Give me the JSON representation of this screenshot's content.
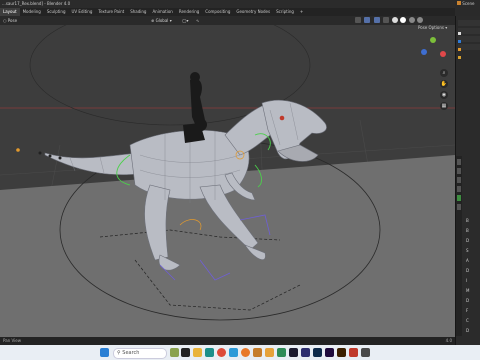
{
  "window": {
    "title": "...saur17_Rex.blend] - Blender 4.0"
  },
  "menubar": {
    "tabs": [
      "Layout",
      "Modeling",
      "Sculpting",
      "UV Editing",
      "Texture Paint",
      "Shading",
      "Animation",
      "Rendering",
      "Compositing",
      "Geometry Nodes",
      "Scripting",
      "+"
    ],
    "active": "Layout"
  },
  "header": {
    "mode": "Pose",
    "transform": "Global",
    "view_options": "Pose Options"
  },
  "outliner": {
    "label": "Scene"
  },
  "statusbar": {
    "left": "Pan View",
    "right": "4.0"
  },
  "properties": {
    "panel_letters": [
      "B",
      "B",
      "D",
      "S",
      "A",
      "D",
      "I",
      "M",
      "D",
      "F",
      "C",
      "D"
    ]
  },
  "taskbar": {
    "search_placeholder": "Search",
    "icon_names": [
      "windows-start",
      "search",
      "file-explorer",
      "task-view",
      "edge",
      "store",
      "mail",
      "photos",
      "chrome",
      "teams",
      "blender",
      "photoshop",
      "after-effects",
      "premiere",
      "illustrator",
      "files"
    ]
  },
  "colors": {
    "viewport_bg": "#3d3d3d",
    "mesh": "#b9bcc4",
    "bone_green": "#4bd04b",
    "accent": "#e39a2d"
  }
}
